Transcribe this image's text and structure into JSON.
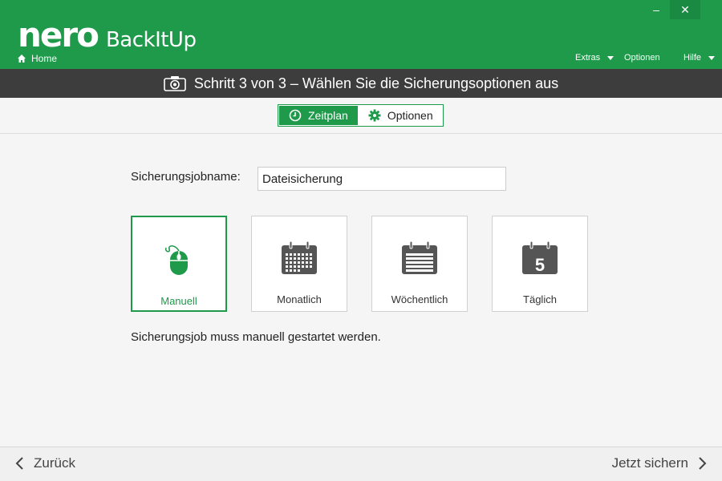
{
  "window": {
    "minimize_label": "–",
    "close_label": "✕"
  },
  "brand": {
    "logo_text": "nero",
    "product": "BackItUp"
  },
  "nav": {
    "home": "Home"
  },
  "menu": {
    "extras": "Extras",
    "optionen": "Optionen",
    "hilfe": "Hilfe"
  },
  "step": {
    "title": "Schritt 3 von 3 – Wählen Sie die Sicherungsoptionen aus"
  },
  "tabs": [
    {
      "label": "Zeitplan",
      "icon": "clock-icon",
      "active": true
    },
    {
      "label": "Optionen",
      "icon": "gear-icon",
      "active": false
    }
  ],
  "job": {
    "label": "Sicherungsjobname:",
    "value": "Dateisicherung"
  },
  "schedule": {
    "options": [
      {
        "label": "Manuell",
        "icon": "mouse-icon",
        "selected": true
      },
      {
        "label": "Monatlich",
        "icon": "calendar-month-icon",
        "selected": false
      },
      {
        "label": "Wöchentlich",
        "icon": "calendar-week-icon",
        "selected": false
      },
      {
        "label": "Täglich",
        "icon": "calendar-day-icon",
        "day_number": "5",
        "selected": false
      }
    ],
    "description": "Sicherungsjob muss manuell gestartet werden."
  },
  "footer": {
    "back": "Zurück",
    "next": "Jetzt sichern"
  },
  "colors": {
    "accent": "#1f9a4b",
    "banner": "#3d3d3d",
    "icon_gray": "#555555"
  }
}
